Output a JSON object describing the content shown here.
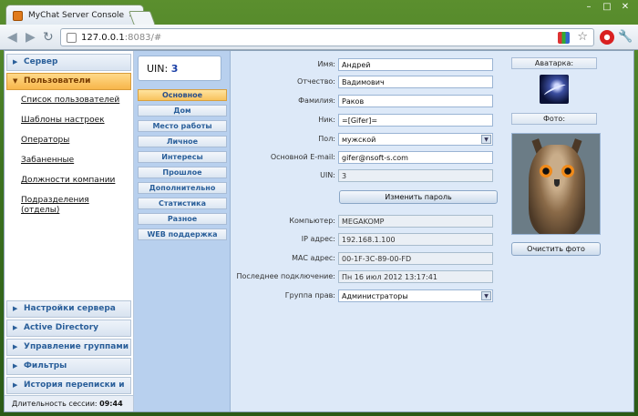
{
  "browser": {
    "tab_title": "MyChat Server Console",
    "url_host": "127.0.0.1",
    "url_rest": ":8083/#"
  },
  "sidebar": {
    "top_items": [
      {
        "label": "Сервер"
      },
      {
        "label": "Пользователи"
      }
    ],
    "sub_items": [
      "Список пользователей",
      "Шаблоны настроек",
      "Операторы",
      "Забаненные",
      "Должности компании",
      "Подразделения (отделы)"
    ],
    "bottom_items": [
      "Настройки сервера",
      "Active Directory",
      "Управление группами",
      "Фильтры",
      "История переписки и логи"
    ],
    "session_label": "Длительность сессии:",
    "session_value": "09:44"
  },
  "middle": {
    "uin_label": "UIN:",
    "uin_value": "3",
    "menu": [
      "Основное",
      "Дом",
      "Место работы",
      "Личное",
      "Интересы",
      "Прошлое",
      "Дополнительно",
      "Статистика",
      "Разное",
      "WEB поддержка"
    ]
  },
  "form": {
    "fields": [
      {
        "label": "Имя:",
        "value": "Андрей"
      },
      {
        "label": "Отчество:",
        "value": "Вадимович"
      },
      {
        "label": "Фамилия:",
        "value": "Раков"
      },
      {
        "label": "Ник:",
        "value": "=[Gifer]="
      },
      {
        "label": "Пол:",
        "value": "мужской"
      },
      {
        "label": "Основной E-mail:",
        "value": "gifer@nsoft-s.com"
      },
      {
        "label": "UIN:",
        "value": "3"
      },
      {
        "label": "Компьютер:",
        "value": "MEGAKOMP"
      },
      {
        "label": "IP адрес:",
        "value": "192.168.1.100"
      },
      {
        "label": "MAC адрес:",
        "value": "00-1F-3C-89-00-FD"
      },
      {
        "label": "Последнее подключение:",
        "value": "Пн 16 июл 2012 13:17:41"
      },
      {
        "label": "Группа прав:",
        "value": "Администраторы"
      }
    ],
    "change_password_label": "Изменить пароль"
  },
  "right": {
    "avatar_caption": "Аватарка:",
    "photo_caption": "Фото:",
    "clear_photo_label": "Очистить фото"
  }
}
